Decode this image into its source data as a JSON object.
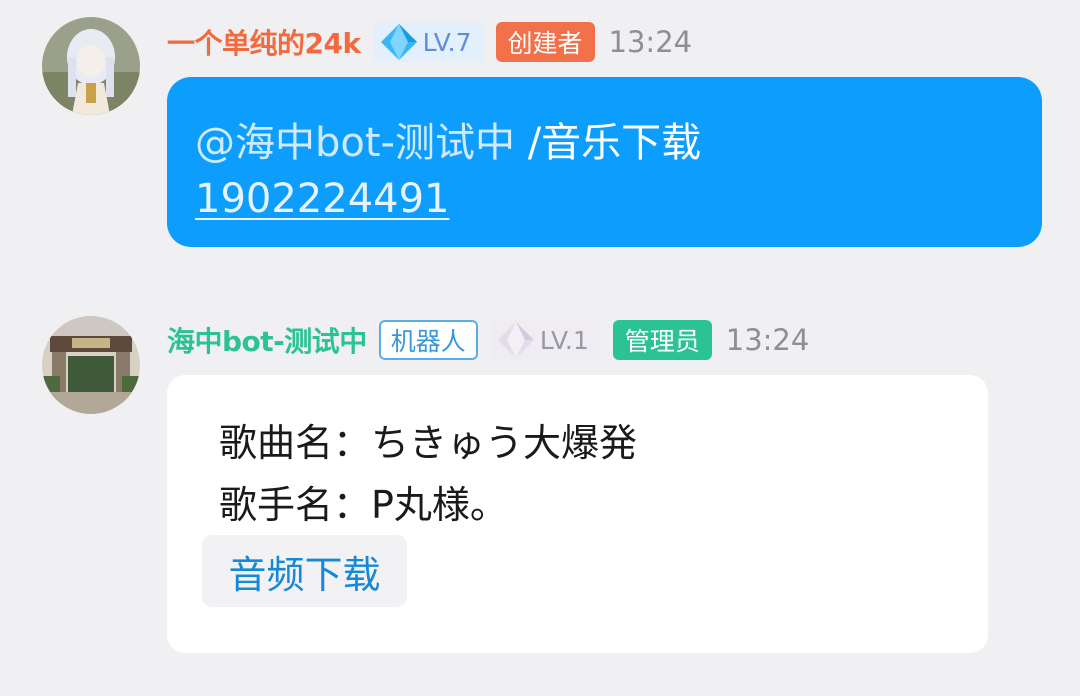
{
  "messages": [
    {
      "sender": "一个单纯的24k",
      "level": "LV.7",
      "role": "创建者",
      "time": "13:24",
      "mention": "@海中bot-测试中",
      "command": " /音乐下载",
      "number": "1902224491",
      "colors": {
        "name": "#f26a3e",
        "role_bg": "#f2714a",
        "bubble": "#0c9dfd"
      }
    },
    {
      "sender": "海中bot-测试中",
      "robot_tag": "机器人",
      "level": "LV.1",
      "role": "管理员",
      "time": "13:24",
      "song_line": "歌曲名：ちきゅう大爆発",
      "artist_line": "歌手名：P丸様。",
      "download_label": "音频下载",
      "colors": {
        "name": "#2cc394",
        "role_bg": "#2cc394",
        "link": "#1589d6"
      }
    }
  ]
}
